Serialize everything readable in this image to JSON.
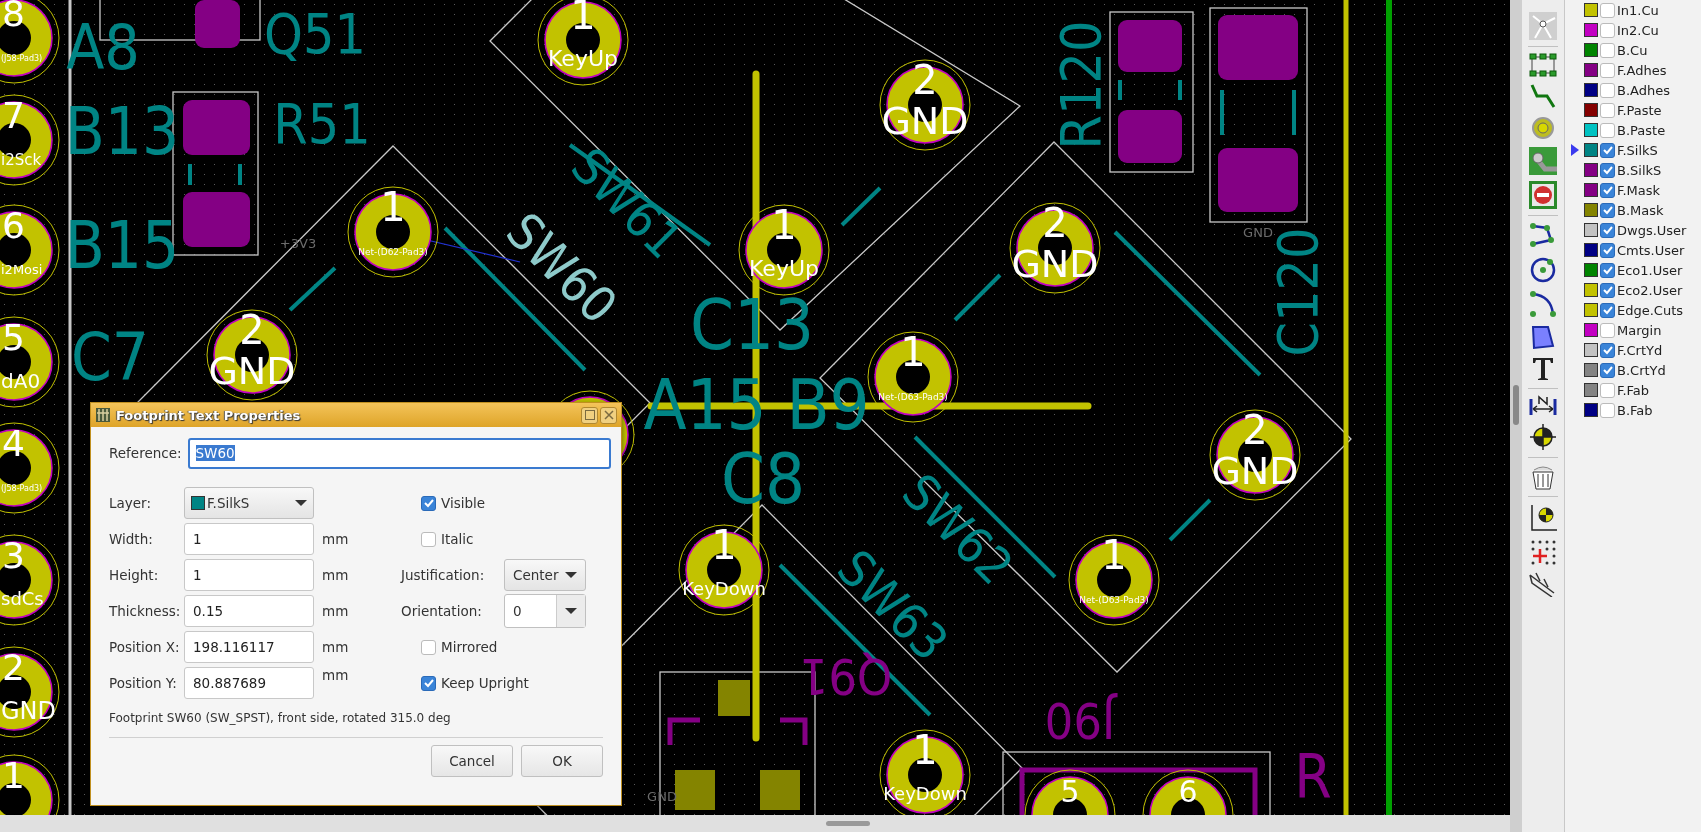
{
  "board": {
    "pads": [
      {
        "number": "8",
        "net": "(J58-Pad3)"
      },
      {
        "number": "7",
        "net": "i2Sck"
      },
      {
        "number": "6",
        "net": "i2Mosi"
      },
      {
        "number": "5",
        "net": "dA0"
      },
      {
        "number": "4",
        "net": "(J58-Pad3)"
      },
      {
        "number": "3",
        "net": "sdCs"
      },
      {
        "number": "2",
        "net": "GND"
      },
      {
        "number": "1"
      },
      {
        "number": "1",
        "net": "KeyUp"
      },
      {
        "number": "2",
        "net": "GND"
      },
      {
        "number": "1",
        "net": "Net-(D62-Pad3)"
      },
      {
        "number": "1",
        "net": "KeyUp"
      },
      {
        "number": "2",
        "net": "GND"
      },
      {
        "number": "2",
        "net": "GND"
      },
      {
        "number": "1",
        "net": "Net-(D63-Pad3)"
      },
      {
        "number": "2",
        "net": "GND"
      },
      {
        "number": "1",
        "net": "KeyDown"
      },
      {
        "number": "1",
        "net": "Net-(D63-Pad3)"
      },
      {
        "number": "1",
        "net": "KeyDown"
      },
      {
        "number": "5"
      },
      {
        "number": "6"
      }
    ],
    "references": [
      {
        "text": "A8",
        "kind": "front",
        "highlighted": false
      },
      {
        "text": "Q51",
        "kind": "front",
        "highlighted": false
      },
      {
        "text": "B13",
        "kind": "front",
        "highlighted": false
      },
      {
        "text": "R51",
        "kind": "front",
        "highlighted": false
      },
      {
        "text": "B15",
        "kind": "front",
        "highlighted": false
      },
      {
        "text": "C7",
        "kind": "front",
        "highlighted": false
      },
      {
        "text": "SW61",
        "kind": "front",
        "highlighted": false
      },
      {
        "text": "SW60",
        "kind": "front",
        "highlighted": true
      },
      {
        "text": "C13",
        "kind": "front",
        "highlighted": false
      },
      {
        "text": "A15",
        "kind": "front",
        "highlighted": false
      },
      {
        "text": "B9",
        "kind": "front",
        "highlighted": false
      },
      {
        "text": "C8",
        "kind": "front",
        "highlighted": false
      },
      {
        "text": "SW62",
        "kind": "front",
        "highlighted": false
      },
      {
        "text": "SW63",
        "kind": "front",
        "highlighted": false
      },
      {
        "text": "R120",
        "kind": "front",
        "highlighted": false
      },
      {
        "text": "C120",
        "kind": "front",
        "highlighted": false
      },
      {
        "text": "Q91",
        "kind": "back",
        "highlighted": false
      },
      {
        "text": "J90",
        "kind": "back",
        "highlighted": false
      },
      {
        "text": "R",
        "kind": "back",
        "highlighted": false
      }
    ],
    "net_labels": [
      "+3V3",
      "GND",
      "GND"
    ]
  },
  "layers": [
    {
      "name": "In1.Cu",
      "color": "#c2c200",
      "visible": false,
      "selected": false
    },
    {
      "name": "In2.Cu",
      "color": "#c200c2",
      "visible": false,
      "selected": false
    },
    {
      "name": "B.Cu",
      "color": "#008400",
      "visible": false,
      "selected": false
    },
    {
      "name": "F.Adhes",
      "color": "#840084",
      "visible": false,
      "selected": false
    },
    {
      "name": "B.Adhes",
      "color": "#000084",
      "visible": false,
      "selected": false
    },
    {
      "name": "F.Paste",
      "color": "#840000",
      "visible": false,
      "selected": false
    },
    {
      "name": "B.Paste",
      "color": "#00c2c2",
      "visible": false,
      "selected": false
    },
    {
      "name": "F.SilkS",
      "color": "#008484",
      "visible": true,
      "selected": true
    },
    {
      "name": "B.SilkS",
      "color": "#840084",
      "visible": true,
      "selected": false
    },
    {
      "name": "F.Mask",
      "color": "#840084",
      "visible": true,
      "selected": false
    },
    {
      "name": "B.Mask",
      "color": "#848400",
      "visible": true,
      "selected": false
    },
    {
      "name": "Dwgs.User",
      "color": "#c2c2c2",
      "visible": true,
      "selected": false
    },
    {
      "name": "Cmts.User",
      "color": "#000084",
      "visible": true,
      "selected": false
    },
    {
      "name": "Eco1.User",
      "color": "#008400",
      "visible": true,
      "selected": false
    },
    {
      "name": "Eco2.User",
      "color": "#c2c200",
      "visible": true,
      "selected": false
    },
    {
      "name": "Edge.Cuts",
      "color": "#c2c200",
      "visible": true,
      "selected": false
    },
    {
      "name": "Margin",
      "color": "#c200c2",
      "visible": false,
      "selected": false
    },
    {
      "name": "F.CrtYd",
      "color": "#c2c2c2",
      "visible": true,
      "selected": false
    },
    {
      "name": "B.CrtYd",
      "color": "#848484",
      "visible": true,
      "selected": false
    },
    {
      "name": "F.Fab",
      "color": "#848484",
      "visible": false,
      "selected": false
    },
    {
      "name": "B.Fab",
      "color": "#000084",
      "visible": false,
      "selected": false
    }
  ],
  "dialog": {
    "title": "Footprint Text Properties",
    "reference": {
      "label": "Reference:",
      "value": "SW60",
      "text_selected": true
    },
    "layer": {
      "label": "Layer:",
      "value": "F.SilkS",
      "color": "#008484"
    },
    "fields": [
      {
        "label": "Width:",
        "value": "1",
        "unit": "mm"
      },
      {
        "label": "Height:",
        "value": "1",
        "unit": "mm"
      },
      {
        "label": "Thickness:",
        "value": "0.15",
        "unit": "mm"
      },
      {
        "label": "Position X:",
        "value": "198.116117",
        "unit": "mm"
      },
      {
        "label": "Position Y:",
        "value": "80.887689",
        "unit": "mm"
      }
    ],
    "options": [
      {
        "kind": "checkbox",
        "label": "Visible",
        "checked": true
      },
      {
        "kind": "checkbox",
        "label": "Italic",
        "checked": false
      },
      {
        "kind": "select",
        "label": "Justification:",
        "value": "Center"
      },
      {
        "kind": "combo",
        "label": "Orientation:",
        "value": "0"
      },
      {
        "kind": "checkbox",
        "label": "Mirrored",
        "checked": false
      },
      {
        "kind": "checkbox",
        "label": "Keep Upright",
        "checked": true
      }
    ],
    "info": "Footprint SW60 (SW_SPST), front side, rotated 315.0 deg",
    "buttons": [
      "Cancel",
      "OK"
    ]
  }
}
